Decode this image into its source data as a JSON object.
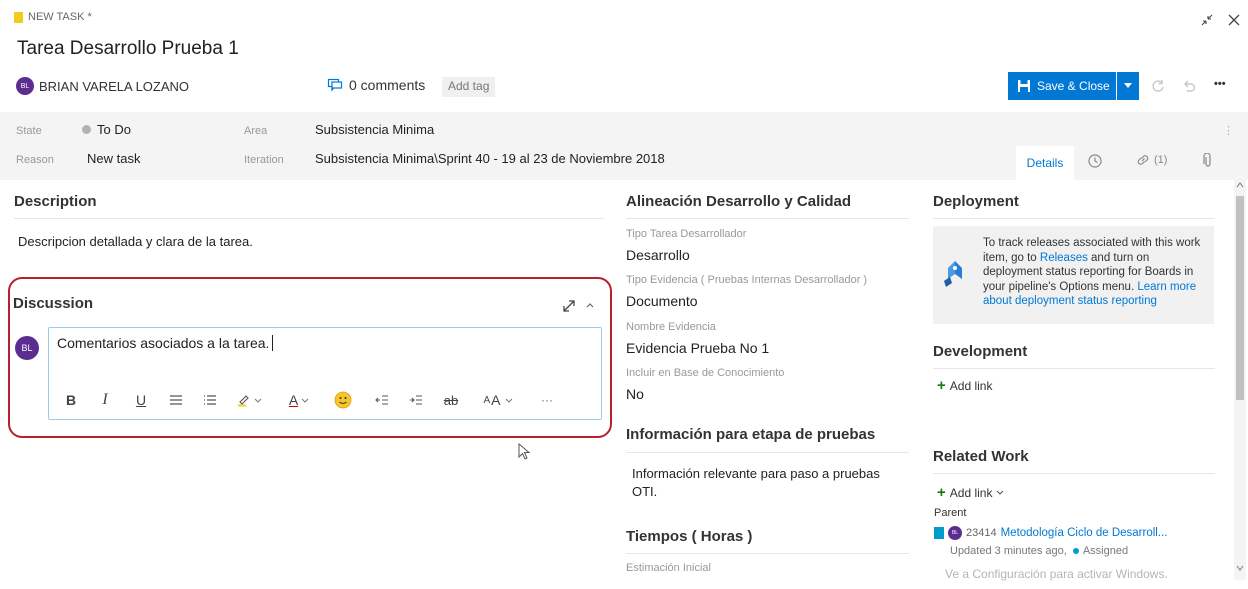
{
  "header": {
    "work_item_type": "NEW TASK *",
    "title": "Tarea Desarrollo Prueba 1",
    "assignee_initials": "BL",
    "assignee_name": "BRIAN VARELA LOZANO",
    "comments_label": "0 comments",
    "add_tag_label": "Add tag",
    "save_close_label": "Save & Close",
    "more_label": "•••"
  },
  "fields": {
    "state_label": "State",
    "state_value": "To Do",
    "reason_label": "Reason",
    "reason_value": "New task",
    "area_label": "Area",
    "area_value": "Subsistencia Minima",
    "iteration_label": "Iteration",
    "iteration_value": "Subsistencia Minima\\Sprint 40 - 19 al 23 de Noviembre 2018"
  },
  "tabs": {
    "details_label": "Details",
    "links_label": "(1)"
  },
  "description": {
    "title": "Description",
    "text": "Descripcion detallada y clara de la tarea."
  },
  "discussion": {
    "title": "Discussion",
    "avatar_initials": "BL",
    "comment_text": "Comentarios asociados a la tarea."
  },
  "alineacion": {
    "title": "Alineación Desarrollo y Calidad",
    "fields": [
      {
        "label": "Tipo Tarea Desarrollador",
        "value": "Desarrollo"
      },
      {
        "label": "Tipo Evidencia ( Pruebas Internas Desarrollador )",
        "value": "Documento"
      },
      {
        "label": "Nombre Evidencia",
        "value": "Evidencia Prueba No 1"
      },
      {
        "label": "Incluir en Base de Conocimiento",
        "value": "No"
      }
    ]
  },
  "info_pruebas": {
    "title": "Información para etapa de pruebas",
    "text": "Información relevante para paso a pruebas OTI."
  },
  "tiempos": {
    "title": "Tiempos ( Horas )",
    "estimacion_label": "Estimación Inicial"
  },
  "deployment": {
    "title": "Deployment",
    "text_1": "To track releases associated with this work item, go to ",
    "releases_link": "Releases",
    "text_2": " and turn on deployment status reporting for Boards in your pipeline's Options menu. ",
    "learn_link": "Learn more about deployment status reporting"
  },
  "development": {
    "title": "Development",
    "add_link_label": "Add link"
  },
  "related_work": {
    "title": "Related Work",
    "add_link_label": "Add link",
    "parent_label": "Parent",
    "parent_avatar_initials": "BL",
    "parent_id": "23414",
    "parent_title": "Metodología Ciclo de Desarroll...",
    "parent_updated": "Updated 3 minutes ago,",
    "parent_state": "Assigned"
  },
  "watermark": {
    "text": "Ve a Configuración para activar Windows."
  },
  "colors": {
    "accent": "#0078d4",
    "highlight_border": "#b7202e",
    "avatar_purple": "#5c2d91",
    "task_yellow": "#f2cb1d"
  }
}
